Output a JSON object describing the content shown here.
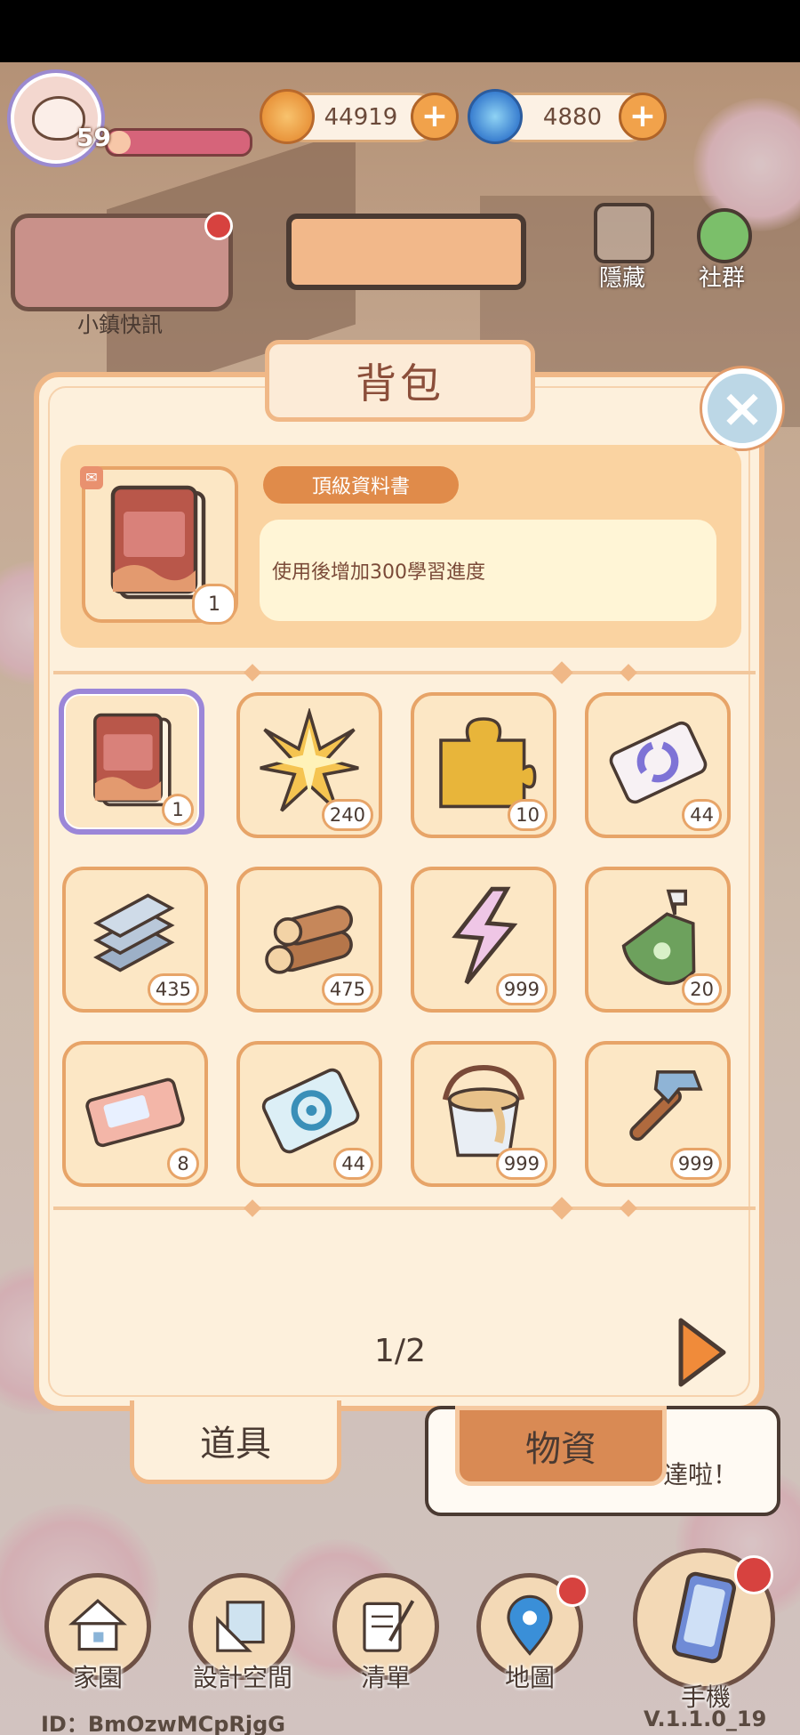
{
  "hud": {
    "level": "59",
    "xp_progress": 0.16,
    "coins": "44919",
    "gems": "4880",
    "plus_symbol": "+"
  },
  "news": {
    "label": "小鎮快訊"
  },
  "side_buttons": {
    "hide": "隱藏",
    "community": "社群"
  },
  "backpack": {
    "title": "背包",
    "close_symbol": "×",
    "selected_item": {
      "name": "頂級資料書",
      "count": "1",
      "description": "使用後增加300學習進度"
    },
    "items": [
      {
        "icon": "book-icon",
        "count": "1",
        "selected": true
      },
      {
        "icon": "star-icon",
        "count": "240"
      },
      {
        "icon": "puzzle-piece-icon",
        "count": "10"
      },
      {
        "icon": "refresh-card-icon",
        "count": "44"
      },
      {
        "icon": "steel-beams-icon",
        "count": "435"
      },
      {
        "icon": "wood-logs-icon",
        "count": "475"
      },
      {
        "icon": "lightning-icon",
        "count": "999"
      },
      {
        "icon": "glue-bottle-icon",
        "count": "20"
      },
      {
        "icon": "ticket-icon",
        "count": "8"
      },
      {
        "icon": "target-card-icon",
        "count": "44"
      },
      {
        "icon": "paint-bucket-icon",
        "count": "999"
      },
      {
        "icon": "hammer-icon",
        "count": "999"
      }
    ],
    "page_indicator": "1/2",
    "tabs": {
      "active": "道具",
      "inactive": "物資"
    }
  },
  "bubble": {
    "text": "達啦！"
  },
  "bottom_nav": [
    {
      "label": "家園",
      "icon": "house-icon"
    },
    {
      "label": "設計空間",
      "icon": "design-ruler-icon"
    },
    {
      "label": "清單",
      "icon": "list-quill-icon"
    },
    {
      "label": "地圖",
      "icon": "map-pin-icon"
    },
    {
      "label": "手機",
      "icon": "phone-icon"
    }
  ],
  "footer": {
    "id": "ID：BmOzwMCpRjgG",
    "version": "V.1.1.0_19"
  },
  "colors": {
    "accent": "#e08b4a",
    "panel": "#fdf0dc",
    "border": "#f0b887",
    "selected": "#9b86d8"
  }
}
